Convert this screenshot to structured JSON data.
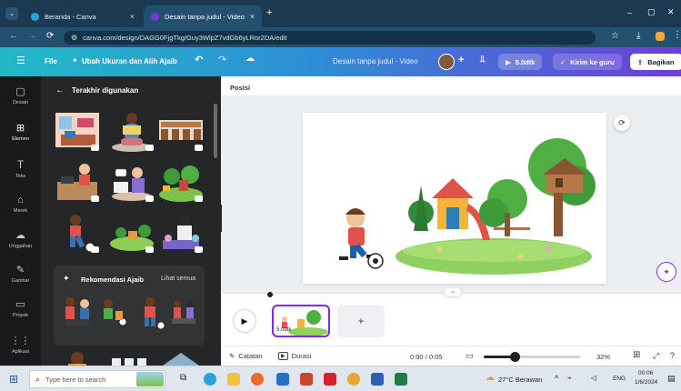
{
  "browser": {
    "tabs": [
      {
        "title": "Beranda - Canva",
        "close": "×"
      },
      {
        "title": "Desain tanpa judul - Video",
        "close": "×"
      }
    ],
    "new_tab": "+",
    "window_controls": {
      "minimize": "–",
      "maximize": "▢",
      "close": "✕"
    },
    "url": "canva.com/design/DAGG0FjgTkg/Guy3WlpZ7vdGb6yLRor2DA/edit"
  },
  "canva": {
    "menu": {
      "file": "File",
      "resize": "Ubah Ukuran dan Alih Ajaib",
      "doc_title": "Desain tanpa judul - Video",
      "add_people": "+",
      "duration": "5.0dtk",
      "send_teacher": "Kirim ke guru",
      "share": "Bagikan"
    },
    "rail": [
      {
        "label": "Desain",
        "icon": "design-icon"
      },
      {
        "label": "Elemen",
        "icon": "elements-icon"
      },
      {
        "label": "Teks",
        "icon": "text-icon"
      },
      {
        "label": "Merek",
        "icon": "brand-icon"
      },
      {
        "label": "Unggahan",
        "icon": "upload-icon"
      },
      {
        "label": "Gambar",
        "icon": "draw-icon"
      },
      {
        "label": "Proyek",
        "icon": "folder-icon"
      },
      {
        "label": "Aplikasi",
        "icon": "apps-icon"
      }
    ],
    "panel": {
      "back": "←",
      "title": "Terakhir digunakan",
      "magic_title": "Rekomendasi Ajaib",
      "see_all": "Lihat semua"
    },
    "context_bar": {
      "position": "Posisi"
    },
    "timeline": {
      "clip_duration": "5.0dtk",
      "add": "+"
    },
    "footer": {
      "notes": "Catatan",
      "duration": "Durasi",
      "time": "0:00 / 0:05",
      "zoom": "32%",
      "zoom_level": 0.32
    }
  },
  "taskbar": {
    "search_placeholder": "Type here to search",
    "weather": "27°C Berawan",
    "lang": "ENG",
    "time": "00:06",
    "date": "1/6/2024"
  },
  "colors": {
    "browser_dark": "#1b3a52",
    "canva_grad_start": "#22b9c7",
    "canva_grad_end": "#6d3ed8",
    "accent_purple": "#7d2ae8"
  }
}
